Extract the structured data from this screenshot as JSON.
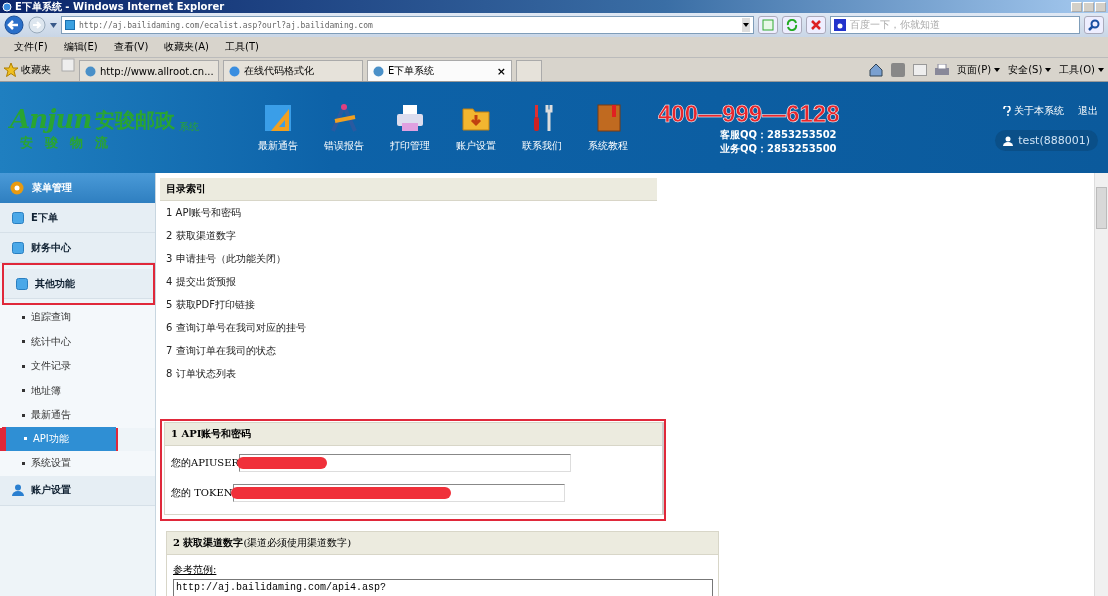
{
  "window": {
    "title": "E下单系统 - Windows Internet Explorer"
  },
  "toolbar": {
    "address": "http://aj.bailidaming.com/ecalist.asp?ourl?aj.bailidaming.com",
    "search_placeholder": "百度一下，你就知道"
  },
  "menu_bar": [
    "文件(F)",
    "编辑(E)",
    "查看(V)",
    "收藏夹(A)",
    "工具(T)"
  ],
  "favorites_bar": {
    "label": "收藏夹",
    "tabs": [
      {
        "label": "http://www.allroot.cn...",
        "selected": false
      },
      {
        "label": "在线代码格式化",
        "selected": false
      },
      {
        "label": "E下单系统",
        "selected": true
      }
    ],
    "close": "×"
  },
  "command_bar": [
    "页面(P)",
    "安全(S)",
    "工具(O)"
  ],
  "header": {
    "logo": "Anjun",
    "brand": "安骏邮政",
    "brand_suffix": "系统",
    "brand_sub": "安骏物流",
    "nav": [
      "最新通告",
      "错误报告",
      "打印管理",
      "账户设置",
      "联系我们",
      "系统教程"
    ],
    "phone": "400—999—6128",
    "qq": [
      "客服QQ：2853253502",
      "业务QQ：2853253500"
    ],
    "about": "关于本系统",
    "logout": "退出",
    "user": "test(888001)"
  },
  "sidebar": {
    "title": "菜单管理",
    "items": [
      {
        "label": "E下单",
        "annotated": false
      },
      {
        "label": "财务中心",
        "annotated": false
      },
      {
        "label": "其他功能",
        "annotated": true,
        "children": [
          {
            "label": "追踪查询",
            "selected": false,
            "annotated": false
          },
          {
            "label": "统计中心",
            "selected": false,
            "annotated": false
          },
          {
            "label": "文件记录",
            "selected": false,
            "annotated": false
          },
          {
            "label": "地址簿",
            "selected": false,
            "annotated": false
          },
          {
            "label": "最新通告",
            "selected": false,
            "annotated": false
          },
          {
            "label": "API功能",
            "selected": true,
            "annotated": true
          },
          {
            "label": "系统设置",
            "selected": false,
            "annotated": false
          }
        ]
      },
      {
        "label": "账户设置",
        "annotated": false
      }
    ]
  },
  "index": {
    "title": "目录索引",
    "items": [
      "1 API账号和密码",
      "2 获取渠道数字",
      "3 申请挂号（此功能关闭）",
      "4 提交出货预报",
      "5 获取PDF打印链接",
      "6 查询订单号在我司对应的挂号",
      "7 查询订单在我司的状态",
      "8 订单状态列表"
    ]
  },
  "sections": [
    {
      "kind": "fields",
      "title": "1 API账号和密码",
      "annotated": true,
      "fields": [
        {
          "label": "您的APIUSER",
          "redacted": true
        },
        {
          "label": "您的 TOKEN",
          "redacted": true
        }
      ]
    },
    {
      "kind": "example",
      "title": "2 获取渠道数字",
      "note": "(渠道必须使用渠道数字)",
      "example_label": "参考范例:",
      "example": "http://aj.bailidaming.com/api4.asp?",
      "annotated": false
    }
  ]
}
